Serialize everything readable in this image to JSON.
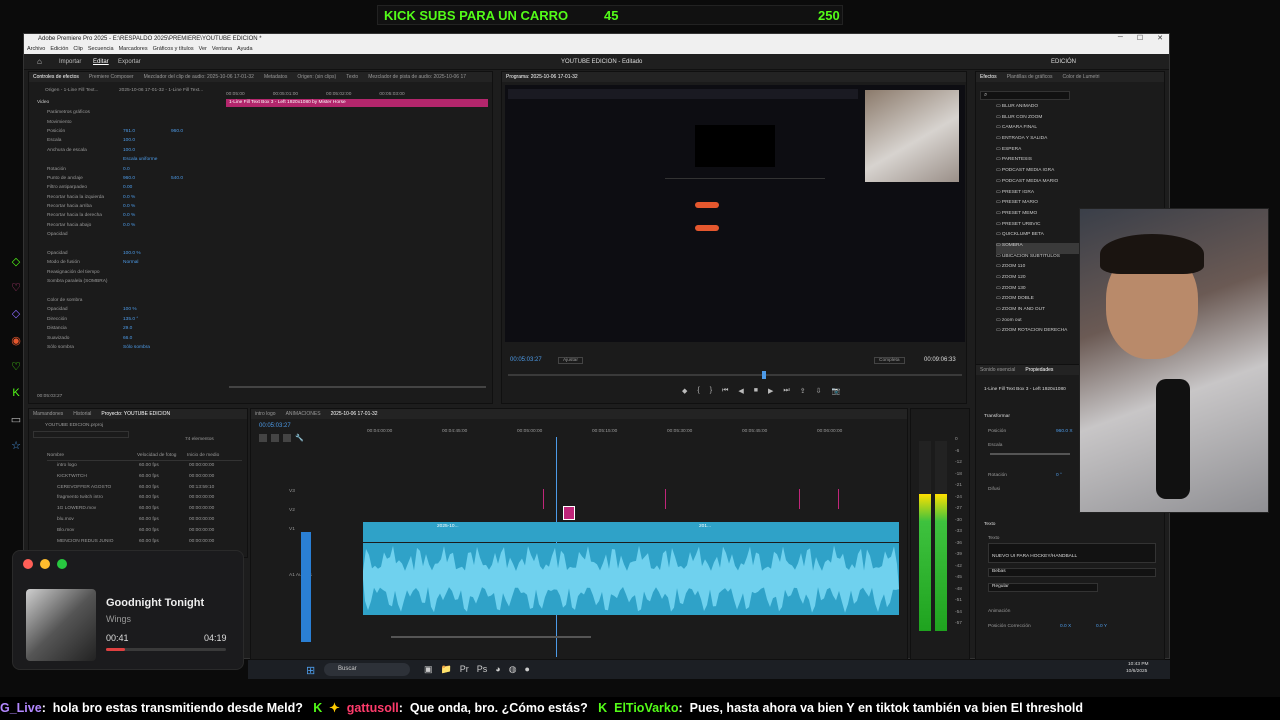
{
  "overlay": {
    "kick_text": "KICK SUBS PARA UN CARRO",
    "subs_current": "45",
    "subs_goal": "250"
  },
  "window": {
    "title": "Adobe Premiere Pro 2025 - E:\\RESPALDO 2025\\PREMIERE\\YOUTUBE EDICION *",
    "menus": [
      "Archivo",
      "Edición",
      "Clip",
      "Secuencia",
      "Marcadores",
      "Gráficos y títulos",
      "Ver",
      "Ventana",
      "Ayuda"
    ],
    "workspaces": [
      "Importar",
      "Editar",
      "Exportar"
    ],
    "project_title": "YOUTUBE EDICION - Editado",
    "right_label": "EDICIÓN"
  },
  "effect_controls": {
    "tabs": [
      "Controles de efectos",
      "Premiere Composer",
      "Mezclador del clip de audio: 2025-10-06 17-01-32",
      "Metadatos",
      "Origen: (sin clips)",
      "Texto",
      "Mezclador de pista de audio: 2025-10-06 17"
    ],
    "source": "Origen - 1-Line Fill Text...",
    "sequence": "2025-10-06 17-01-32 - 1-Line Fill Text...",
    "timecodes": [
      "00:05:00",
      "00:05:01:00",
      "00:05:02:00",
      "00:05:03:00"
    ],
    "clip_label": "1-Line Fill Text Box 3 - Left 1920x1080 by Mister Horse",
    "section_video": "Video",
    "rows": [
      {
        "label": "Parámetros gráficos",
        "v1": "",
        "v2": ""
      },
      {
        "label": "Movimiento",
        "v1": "",
        "v2": ""
      },
      {
        "label": "Posición",
        "v1": "761.0",
        "v2": "960.0"
      },
      {
        "label": "Escala",
        "v1": "100.0",
        "v2": ""
      },
      {
        "label": "Anchura de escala",
        "v1": "100.0",
        "v2": ""
      },
      {
        "label": "",
        "v1": "Escala uniforme",
        "v2": ""
      },
      {
        "label": "Rotación",
        "v1": "0.0",
        "v2": ""
      },
      {
        "label": "Punto de anclaje",
        "v1": "960.0",
        "v2": "540.0"
      },
      {
        "label": "Filtro antiparpadeo",
        "v1": "0.00",
        "v2": ""
      },
      {
        "label": "Recortar hacia la izquierda",
        "v1": "0.0 %",
        "v2": ""
      },
      {
        "label": "Recortar hacia arriba",
        "v1": "0.0 %",
        "v2": ""
      },
      {
        "label": "Recortar hacia la derecha",
        "v1": "0.0 %",
        "v2": ""
      },
      {
        "label": "Recortar hacia abajo",
        "v1": "0.0 %",
        "v2": ""
      },
      {
        "label": "Opacidad",
        "v1": "",
        "v2": ""
      },
      {
        "label": "",
        "v1": "",
        "v2": ""
      },
      {
        "label": "Opacidad",
        "v1": "100.0 %",
        "v2": ""
      },
      {
        "label": "Modo de fusión",
        "v1": "Normal",
        "v2": ""
      },
      {
        "label": "Reasignación del tiempo",
        "v1": "",
        "v2": ""
      },
      {
        "label": "Sombra paralela (SOMBRA)",
        "v1": "",
        "v2": ""
      },
      {
        "label": "",
        "v1": "",
        "v2": ""
      },
      {
        "label": "Color de sombra",
        "v1": "",
        "v2": ""
      },
      {
        "label": "Opacidad",
        "v1": "100 %",
        "v2": ""
      },
      {
        "label": "Dirección",
        "v1": "135.0 °",
        "v2": ""
      },
      {
        "label": "Distancia",
        "v1": "29.0",
        "v2": ""
      },
      {
        "label": "Suavizado",
        "v1": "66.0",
        "v2": ""
      },
      {
        "label": "Sólo sombra",
        "v1": "Sólo sombra",
        "v2": ""
      }
    ],
    "bottom_time": "00:05:03:27"
  },
  "program": {
    "title": "Programa: 2025-10-06 17-01-32",
    "timecode": "00:05:03:27",
    "fit": "Ajustar",
    "quality": "Completa",
    "duration": "00:09:06:33"
  },
  "project": {
    "tabs": [
      "Mamandones",
      "Historial",
      "Proyecto: YOUTUBE EDICION"
    ],
    "file": "YOUTUBE EDICION.prproj",
    "count": "74 elementos",
    "columns": [
      "Nombre",
      "Velocidad de fotog",
      "Inicio de medio"
    ],
    "items": [
      {
        "name": "intro logo",
        "fps": "60.00 fps",
        "start": "00:00:00:00"
      },
      {
        "name": "KICKTWITCH",
        "fps": "60.00 fps",
        "start": "00:00:00:00"
      },
      {
        "name": "CEREVOFFER AGOSTO",
        "fps": "60.00 fps",
        "start": "00:13:59:10"
      },
      {
        "name": "fragmento twitch intro",
        "fps": "60.00 fps",
        "start": "00:00:00:00"
      },
      {
        "name": "1G LOWERD.mov",
        "fps": "60.00 fps",
        "start": "00:00:00:00"
      },
      {
        "name": "blu.mov",
        "fps": "60.00 fps",
        "start": "00:00:00:00"
      },
      {
        "name": "Blo.mov",
        "fps": "60.00 fps",
        "start": "00:00:00:00"
      },
      {
        "name": "MENCION REDUS JUNIO",
        "fps": "60.00 fps",
        "start": "00:00:00:00"
      }
    ]
  },
  "timeline": {
    "tabs": [
      "intro logo",
      "ANIMACIONES",
      "2025-10-06 17-01-32"
    ],
    "timecode": "00:05:03:27",
    "ruler": [
      "00:04:00:00",
      "00:04:45:00",
      "00:05:00:00",
      "00:05:15:00",
      "00:05:30:00",
      "00:05:45:00",
      "00:06:00:00"
    ],
    "tracks": [
      {
        "id": "V3",
        "name": ""
      },
      {
        "id": "V2",
        "name": ""
      },
      {
        "id": "V1",
        "name": ""
      },
      {
        "id": "A1",
        "name": "Audio 1"
      }
    ],
    "clip_labels": [
      "2025-10...",
      "201..."
    ],
    "footer": "Clic Mayús, Alt y Ctrl para otras opciones."
  },
  "meter": {
    "scale": [
      "0",
      "-6",
      "-12",
      "-18",
      "-21",
      "-24",
      "-27",
      "-30",
      "-33",
      "-36",
      "-39",
      "-42",
      "-45",
      "-48",
      "-51",
      "-54",
      "-57"
    ],
    "level": 0.72
  },
  "effects": {
    "tabs": [
      "Efectos",
      "Plantillas de gráficos",
      "Color de Lumetri"
    ],
    "items": [
      "BLUR ANIMADO",
      "BLUR CON ZOOM",
      "CAMARA FINAL",
      "ENTRADA Y SALIDA",
      "ESPERA",
      "PARENTESIS",
      "PODCAST MEDIA IGRA",
      "PODCAST MEDIA MARIO",
      "PRESET IGRA",
      "PRESET MARIO",
      "PRESET MEMO",
      "PRESET URBVIC",
      "QUICKLUMP BETA",
      "SOMBRA",
      "UBICACION SUBTITULOS",
      "ZOOM 110",
      "ZOOM 120",
      "ZOOM 130",
      "ZOOM DOBLE",
      "ZOOM IN AND OUT",
      "zoom out",
      "ZOOM ROTACION DERECHA"
    ]
  },
  "properties": {
    "tabs": [
      "Sonido esencial",
      "Propiedades"
    ],
    "clip": "1-Line Fill Text Box 3 - Left 1920x1080",
    "transform": "Transformar",
    "position_label": "Posición",
    "position_value": "960.0 X",
    "scale_label": "Escala",
    "rotation_label": "Rotación",
    "rotation_value": "0 °",
    "opacity_label": "Difusi",
    "text_section": "Texto",
    "text_label": "Texto",
    "text_value": "NUEVO UI PARA HOCKEY/HANDBALL",
    "font": "Bebas",
    "style": "Regular",
    "animation": "Animación",
    "pos_correction": "Posición Corrección",
    "pc_x": "0.0 X",
    "pc_y": "0.0 Y"
  },
  "music": {
    "title": "Goodnight Tonight",
    "artist": "Wings",
    "current": "00:41",
    "total": "04:19",
    "progress": 0.16
  },
  "taskbar": {
    "search": "Buscar",
    "time": "10:43 PM",
    "date": "10/6/2025"
  },
  "chat": [
    {
      "user": "G_Live",
      "color": "#b388ff",
      "msg": "hola bro  estas transmitiendo desde Meld?"
    },
    {
      "user": "gattusoll",
      "color": "#ff3b6b",
      "msg": "Que onda, bro. ¿Cómo estás?"
    },
    {
      "user": "ElTioVarko",
      "color": "#53fc18",
      "msg": "Pues, hasta ahora va bien  Y en tiktok también va bien  El threshold"
    }
  ],
  "colors": {
    "accent_blue": "#4d9be8",
    "clip_cyan": "#2fa2c8",
    "kick_green": "#53fc18",
    "chip_orange": "#e4572e",
    "timeline_pink": "#c0267a"
  }
}
